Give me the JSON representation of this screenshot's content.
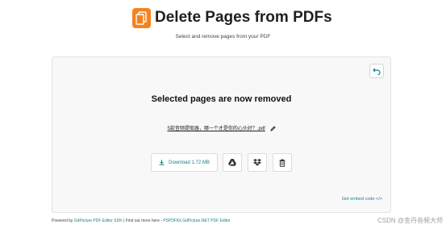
{
  "header": {
    "title": "Delete Pages from PDFs",
    "subtitle": "Select and remove pages from your PDF"
  },
  "panel": {
    "status": "Selected pages are now removed",
    "file_name": "5款音频提取器，哪一个才是你的心头好？.pdf",
    "download_label": "Download 1.72 MB",
    "embed_label": "Get embed code </>"
  },
  "footer": {
    "powered_by": "Powered by ",
    "sdk_link": "GdPicture PDF Editor SDK",
    "separator": " | Find out more here - ",
    "pspdfkit_link": "PSPDFKit GdPicture.NET PDF Editor"
  },
  "watermark": "CSDN @金丹音频大师",
  "colors": {
    "brand_orange": "#f5821f",
    "accent_teal": "#1a7f8a"
  },
  "icons": [
    "document-stack-icon",
    "undo-icon",
    "edit-icon",
    "download-icon",
    "google-drive-icon",
    "dropbox-icon",
    "trash-icon"
  ]
}
